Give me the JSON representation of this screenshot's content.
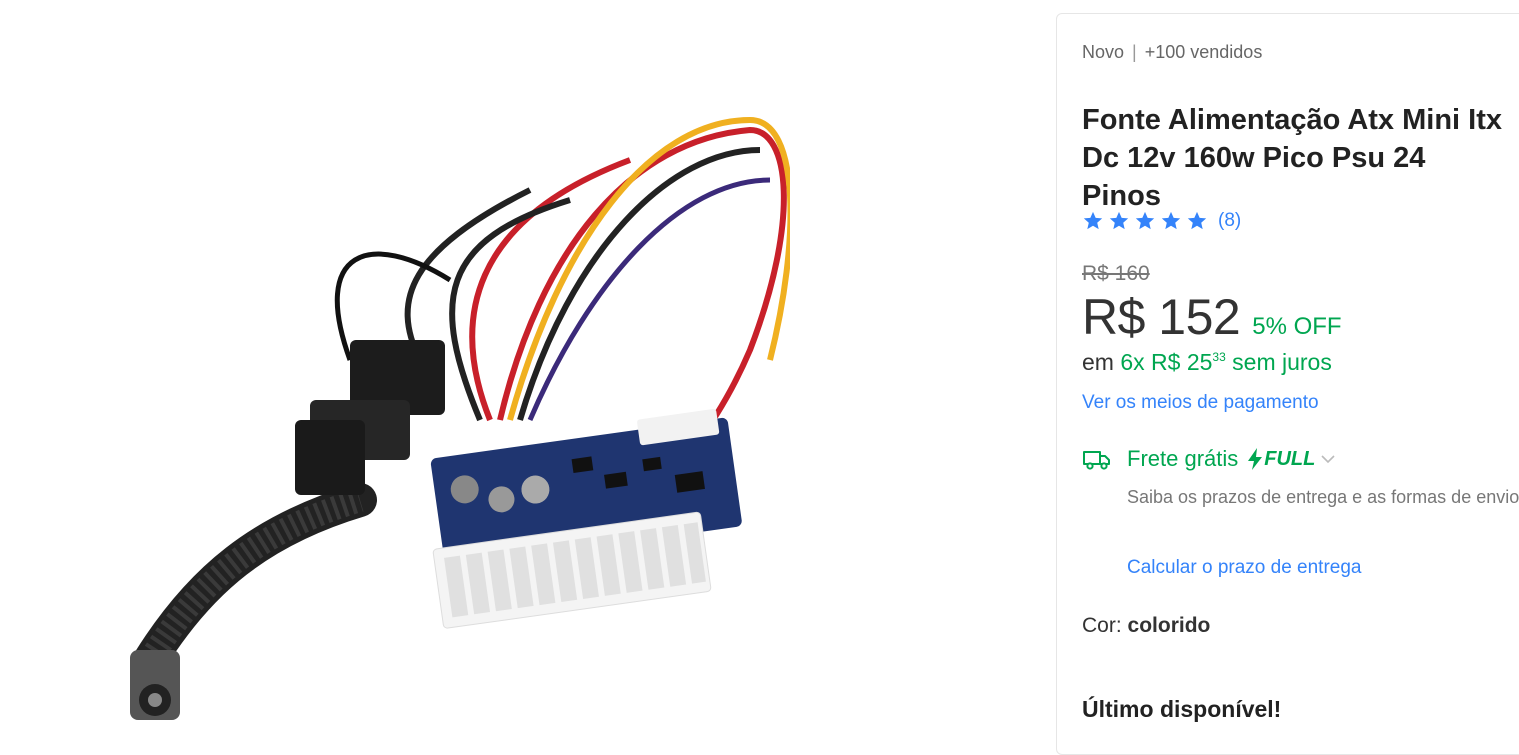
{
  "product": {
    "condition": "Novo",
    "sold": "+100 vendidos",
    "title": "Fonte Alimentação Atx Mini Itx Dc 12v 160w Pico Psu 24 Pinos",
    "rating_count": "(8)",
    "rating_stars": 5,
    "old_price": "R$ 160",
    "price": "R$ 152",
    "discount": "5% OFF",
    "installment_prefix": "em",
    "installment_count": "6x",
    "installment_value": "R$ 25",
    "installment_cents": "33",
    "installment_suffix": "sem juros",
    "payment_link": "Ver os meios de pagamento",
    "shipping_label": "Frete grátis",
    "shipping_badge": "FULL",
    "shipping_desc": "Saiba os prazos de entrega e as formas de envio.",
    "shipping_link": "Calcular o prazo de entrega",
    "color_label": "Cor:",
    "color_value": "colorido",
    "stock_msg": "Último disponível!"
  },
  "icons": {
    "star": "star-icon",
    "truck": "truck-icon",
    "bolt": "lightning-icon",
    "chevron": "chevron-down-icon"
  },
  "colors": {
    "accent_blue": "#3483fa",
    "green": "#00a650",
    "text": "#333333"
  }
}
